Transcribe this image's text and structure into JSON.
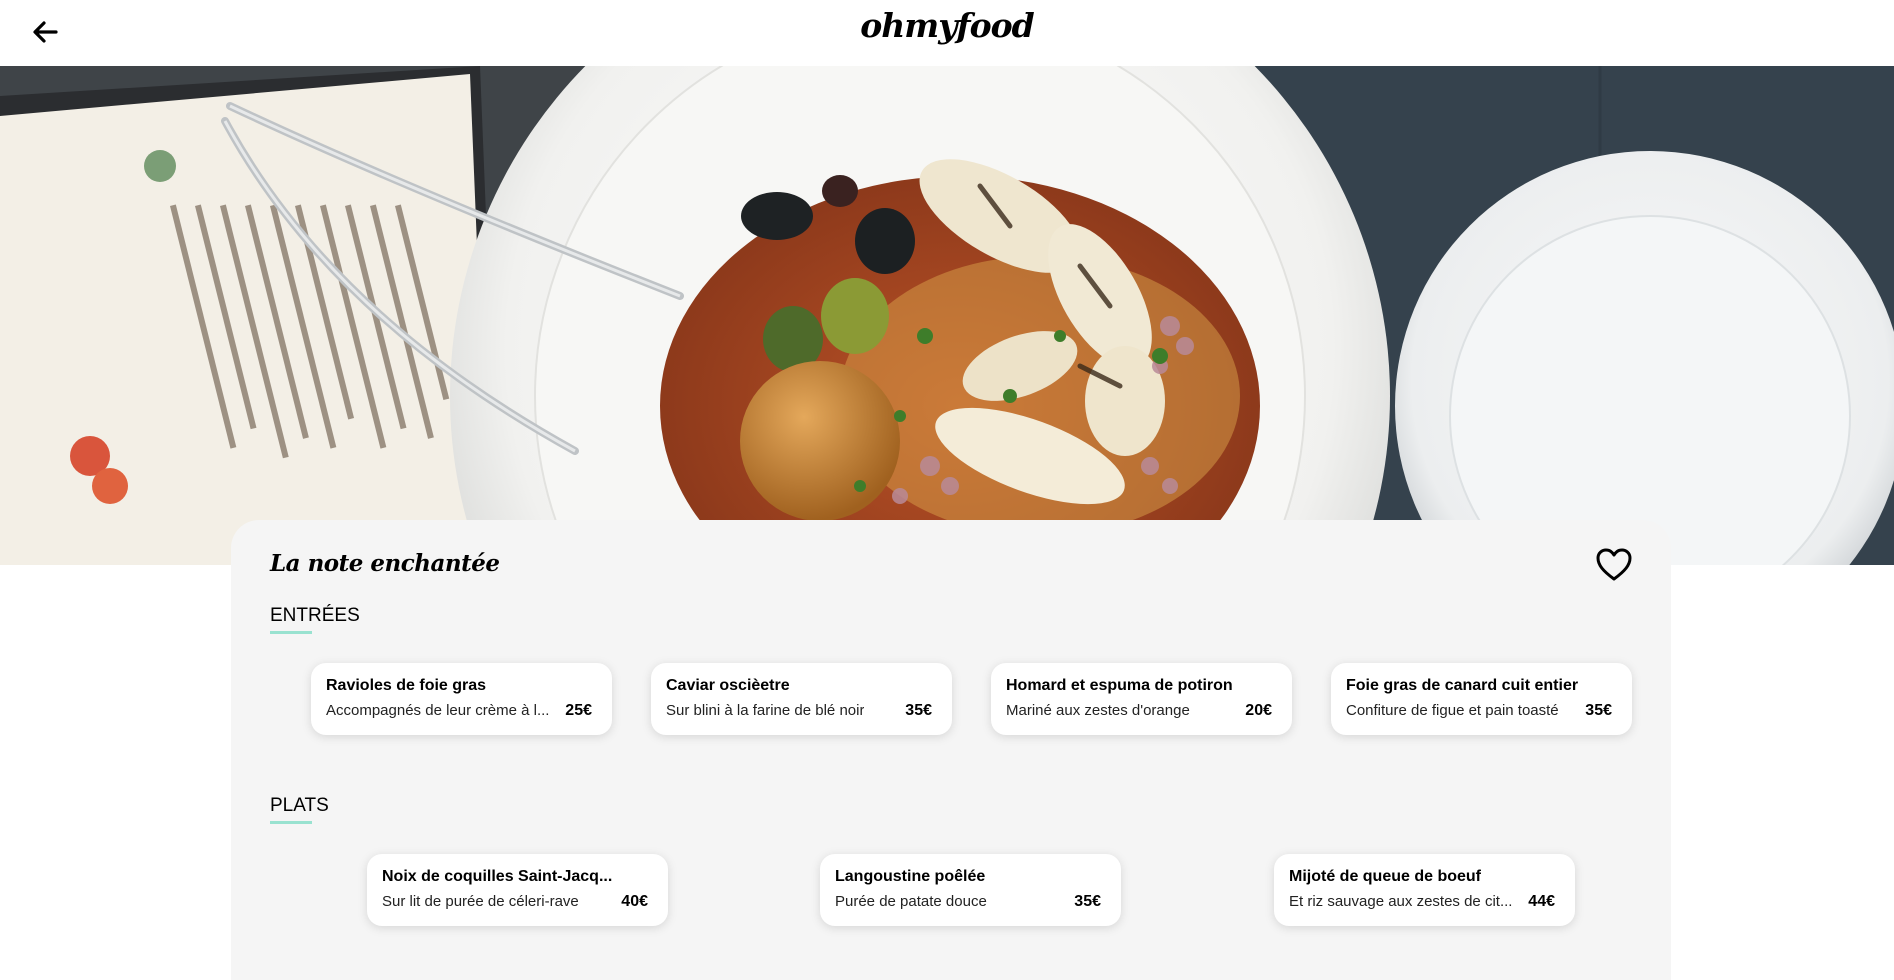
{
  "header": {
    "logo": "ohmyfood",
    "back_icon": "arrow-left-icon"
  },
  "hero": {
    "icon": "food-photo-image"
  },
  "restaurant": {
    "name": "La note enchantée",
    "favorite_icon": "heart-outline-icon"
  },
  "sections": [
    {
      "title": "ENTRÉES",
      "dishes": [
        {
          "name": "Ravioles de foie gras",
          "description": "Accompagnés de leur crème à l...",
          "price": "25€"
        },
        {
          "name": "Caviar oscièetre",
          "description": "Sur blini à la farine de blé noir",
          "price": "35€"
        },
        {
          "name": "Homard et espuma de potiron",
          "description": "Mariné aux zestes d'orange",
          "price": "20€"
        },
        {
          "name": "Foie gras de canard cuit entier",
          "description": "Confiture de figue et pain toasté",
          "price": "35€"
        }
      ]
    },
    {
      "title": "PLATS",
      "dishes": [
        {
          "name": "Noix de coquilles Saint-Jacq...",
          "description": "Sur lit de purée de céleri-rave",
          "price": "40€"
        },
        {
          "name": "Langoustine poêlée",
          "description": "Purée de patate douce",
          "price": "35€"
        },
        {
          "name": "Mijoté de queue de boeuf",
          "description": "Et riz sauvage aux zestes de cit...",
          "price": "44€"
        }
      ]
    }
  ],
  "colors": {
    "accent": "#99e2d0",
    "card_bg": "#f5f5f5"
  }
}
